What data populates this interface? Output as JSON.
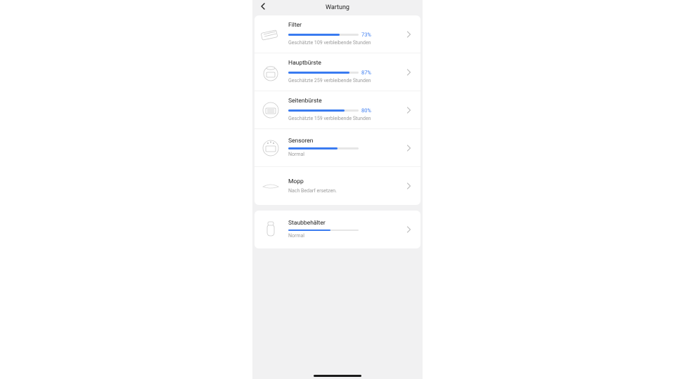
{
  "header": {
    "title": "Wartung"
  },
  "groups": [
    {
      "items": [
        {
          "id": "filter",
          "title": "Filter",
          "progress": 73,
          "showPct": true,
          "sub": "Geschätzte 109 verbleibende Stunden",
          "icon": "filter"
        },
        {
          "id": "hauptbuerste",
          "title": "Hauptbürste",
          "progress": 87,
          "showPct": true,
          "sub": "Geschätzte 259 verbleibende Stunden",
          "icon": "robot"
        },
        {
          "id": "seitenbuerste",
          "title": "Seitenbürste",
          "progress": 80,
          "showPct": true,
          "sub": "Geschätzte 159 verbleibende Stunden",
          "icon": "robot"
        },
        {
          "id": "sensoren",
          "title": "Sensoren",
          "progress": 70,
          "showPct": false,
          "sub": "Normal",
          "icon": "robot"
        },
        {
          "id": "mopp",
          "title": "Mopp",
          "progress": null,
          "showPct": false,
          "sub": "Nach Bedarf ersetzen.",
          "icon": "pad"
        }
      ]
    },
    {
      "items": [
        {
          "id": "staubbehaelter",
          "title": "Staubbehälter",
          "progress": 60,
          "showPct": false,
          "sub": "Normal",
          "icon": "bin"
        }
      ]
    }
  ]
}
